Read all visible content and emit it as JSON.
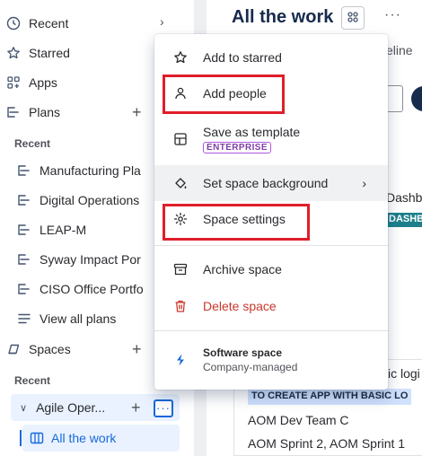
{
  "sidebar": {
    "recent": "Recent",
    "starred": "Starred",
    "apps": "Apps",
    "plans": "Plans",
    "plans_recent_label": "Recent",
    "plan_items": [
      "Manufacturing Pla",
      "Digital Operations",
      "LEAP-M",
      "Syway Impact Por",
      "CISO Office Portfo"
    ],
    "view_all_plans": "View all plans",
    "spaces": "Spaces",
    "spaces_recent_label": "Recent",
    "agile_space": "Agile Oper...",
    "all_the_work": "All the work"
  },
  "main": {
    "title": "All the work",
    "timeline_tab": "eline",
    "dash_text": "Dashb",
    "dash_badge": "DASHB",
    "basic_logi": "ic logi",
    "to_create": "TO CREATE APP WITH BASIC LO",
    "aom1": "AOM Dev Team C",
    "aom2": "AOM Sprint 2, AOM Sprint 1"
  },
  "menu": {
    "add_to_starred": "Add to starred",
    "add_people": "Add people",
    "save_as_template": "Save as template",
    "enterprise_badge": "ENTERPRISE",
    "set_space_background": "Set space background",
    "space_settings": "Space settings",
    "archive_space": "Archive space",
    "delete_space": "Delete space",
    "software_space": "Software space",
    "company_managed": "Company-managed"
  },
  "colors": {
    "accent": "#1868db",
    "highlight": "#e01e2a",
    "danger": "#c9372c",
    "enterprise": "#803fa5"
  }
}
